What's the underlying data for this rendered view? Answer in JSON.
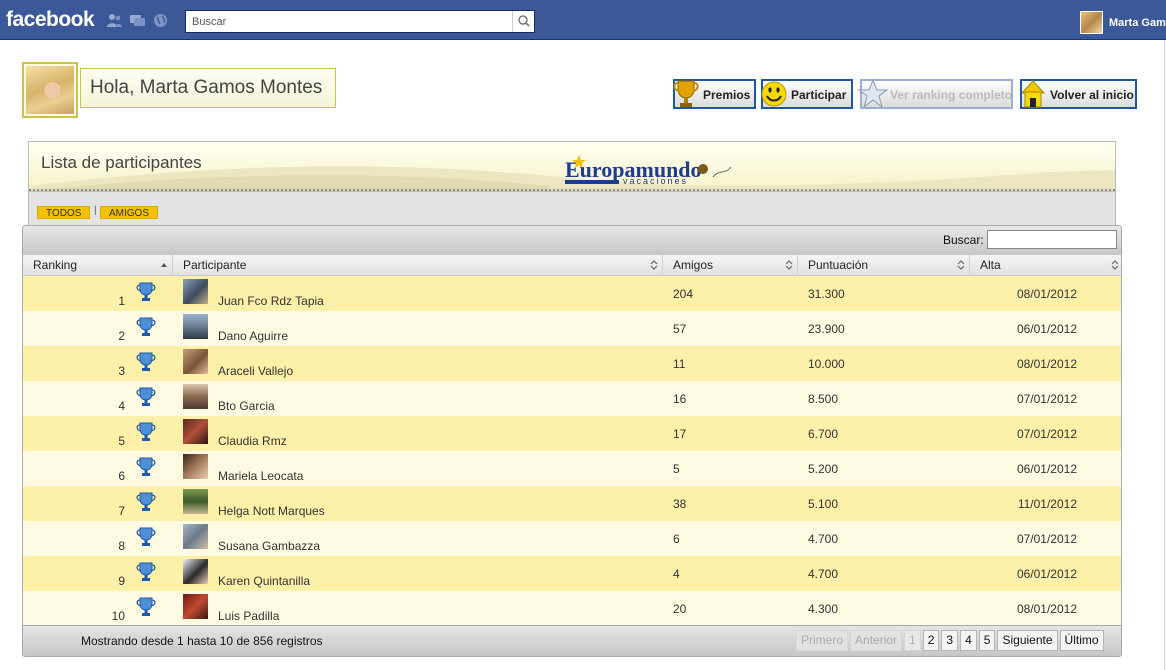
{
  "facebook": {
    "logo": "facebook",
    "search_placeholder": "Buscar",
    "user_name": "Marta Gam"
  },
  "header": {
    "greeting": "Hola, Marta Gamos Montes"
  },
  "actions": {
    "premios": "Premios",
    "participar": "Participar",
    "ranking": "Ver ranking completo",
    "volver": "Volver al inicio"
  },
  "banner": {
    "title": "Lista de participantes",
    "brand": "Europamundo",
    "brand_sub": "vacaciones"
  },
  "filters": {
    "todos": "TODOS",
    "separator": "|",
    "amigos": "AMIGOS"
  },
  "table": {
    "search_label": "Buscar:",
    "columns": {
      "ranking": "Ranking",
      "participante": "Participante",
      "amigos": "Amigos",
      "puntuacion": "Puntuación",
      "alta": "Alta"
    },
    "rows": [
      {
        "rank": "1",
        "name": "Juan Fco Rdz Tapia",
        "amigos": "204",
        "puntuacion": "31.300",
        "alta": "08/01/2012"
      },
      {
        "rank": "2",
        "name": "Dano Aguirre",
        "amigos": "57",
        "puntuacion": "23.900",
        "alta": "06/01/2012"
      },
      {
        "rank": "3",
        "name": "Araceli Vallejo",
        "amigos": "11",
        "puntuacion": "10.000",
        "alta": "08/01/2012"
      },
      {
        "rank": "4",
        "name": "Bto Garcia",
        "amigos": "16",
        "puntuacion": "8.500",
        "alta": "07/01/2012"
      },
      {
        "rank": "5",
        "name": "Claudia Rmz",
        "amigos": "17",
        "puntuacion": "6.700",
        "alta": "07/01/2012"
      },
      {
        "rank": "6",
        "name": "Mariela Leocata",
        "amigos": "5",
        "puntuacion": "5.200",
        "alta": "06/01/2012"
      },
      {
        "rank": "7",
        "name": "Helga Nott Marques",
        "amigos": "38",
        "puntuacion": "5.100",
        "alta": "11/01/2012"
      },
      {
        "rank": "8",
        "name": "Susana Gambazza",
        "amigos": "6",
        "puntuacion": "4.700",
        "alta": "07/01/2012"
      },
      {
        "rank": "9",
        "name": "Karen Quintanilla",
        "amigos": "4",
        "puntuacion": "4.700",
        "alta": "06/01/2012"
      },
      {
        "rank": "10",
        "name": "Luis Padilla",
        "amigos": "20",
        "puntuacion": "4.300",
        "alta": "08/01/2012"
      }
    ],
    "info": "Mostrando desde 1 hasta 10 de 856 registros",
    "pager": {
      "first": "Primero",
      "prev": "Anterior",
      "p1": "1",
      "p2": "2",
      "p3": "3",
      "p4": "4",
      "p5": "5",
      "next": "Siguiente",
      "last": "Último"
    }
  },
  "colors": {
    "facebook_blue": "#3b5998",
    "row_odd": "#fdf0a8",
    "row_even": "#fffbe3",
    "filter_tab": "#f2c200",
    "button_border": "#1e56a0"
  },
  "icons": [
    "friends-icon",
    "messages-icon",
    "globe-icon",
    "search-icon",
    "trophy-icon",
    "smiley-icon",
    "star-icon",
    "home-icon",
    "sort-icon"
  ]
}
